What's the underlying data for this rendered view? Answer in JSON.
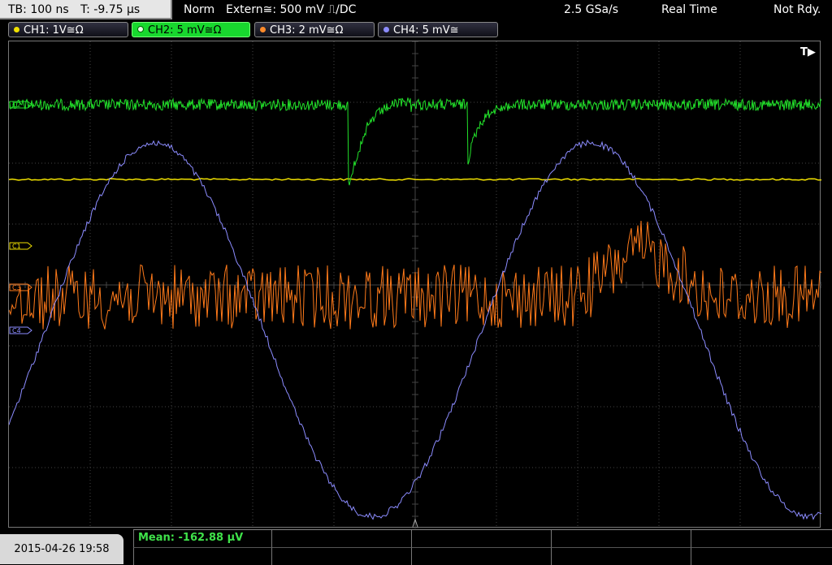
{
  "status": {
    "timebase": "TB: 100 ns",
    "trigger_time": "T: -9.75 µs",
    "trigger_mode": "Norm",
    "trigger_source": "Extern≅: 500 mV ⎍/DC",
    "sample_rate": "2.5 GSa/s",
    "acq_mode": "Real Time",
    "ready_state": "Not Rdy."
  },
  "channels": [
    {
      "label": "CH1: 1V≅Ω",
      "color": "#f0e000",
      "active": false
    },
    {
      "label": "CH2: 5 mV≅Ω",
      "color": "#18d82e",
      "active": true
    },
    {
      "label": "CH3: 2 mV≅Ω",
      "color": "#ff8a2a",
      "active": false
    },
    {
      "label": "CH4: 5 mV≅",
      "color": "#8c8cff",
      "active": false
    }
  ],
  "markers": {
    "c1": "C1",
    "c2": "C2",
    "c3": "C3",
    "c4": "C4",
    "trigger_pos": "T▶"
  },
  "footer": {
    "datetime": "2015-04-26 19:58",
    "measurement": "Mean: -162.88 µV"
  },
  "colors": {
    "ch1": "#f0e000",
    "ch2": "#22e02a",
    "ch3": "#ff7a1a",
    "ch4": "#8c8cff",
    "grid": "#444444"
  }
}
